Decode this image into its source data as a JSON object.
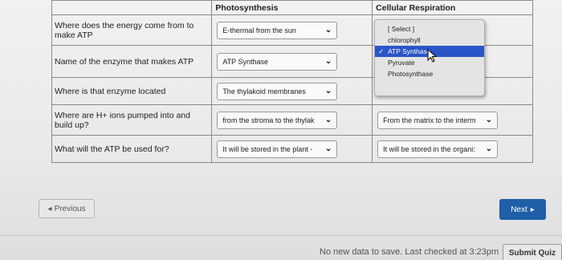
{
  "table": {
    "headers": [
      "",
      "Photosynthesis",
      "Cellular Respiration"
    ],
    "rows": [
      {
        "question": "Where does the energy come from to make ATP",
        "photosynthesis": "E-thermal from the sun",
        "respiration": ""
      },
      {
        "question": "Name of the enzyme that makes ATP",
        "photosynthesis": "ATP Synthase",
        "respiration": ""
      },
      {
        "question": "Where is that enzyme located",
        "photosynthesis": "The thylakoid membranes",
        "respiration": ""
      },
      {
        "question": "Where are H+ ions pumped into and build up?",
        "photosynthesis": "from the stroma to the thylak",
        "respiration": "From the matrix to the interm"
      },
      {
        "question": "What will the ATP be used for?",
        "photosynthesis": "It will be stored in the plant -",
        "respiration": "It will be stored in the organi:"
      }
    ]
  },
  "dropdown": {
    "options": [
      "[ Select ]",
      "chlorophyll",
      "ATP Synthase",
      "Pyruvate",
      "Photosynthase"
    ],
    "selected_index": 2,
    "check_glyph": "✓"
  },
  "nav": {
    "previous_label": "Previous",
    "next_label": "Next",
    "prev_arrow": "◂",
    "next_arrow": "▸"
  },
  "footer": {
    "status": "No new data to save. Last checked at 3:23pm",
    "submit_label": "Submit Quiz"
  },
  "colors": {
    "accent": "#1f5fa8",
    "selected_option": "#2a55c8"
  },
  "icons": {
    "select_chevron": "chevron-down-icon",
    "cursor": "pointer-cursor-icon",
    "check": "checkmark-icon"
  }
}
